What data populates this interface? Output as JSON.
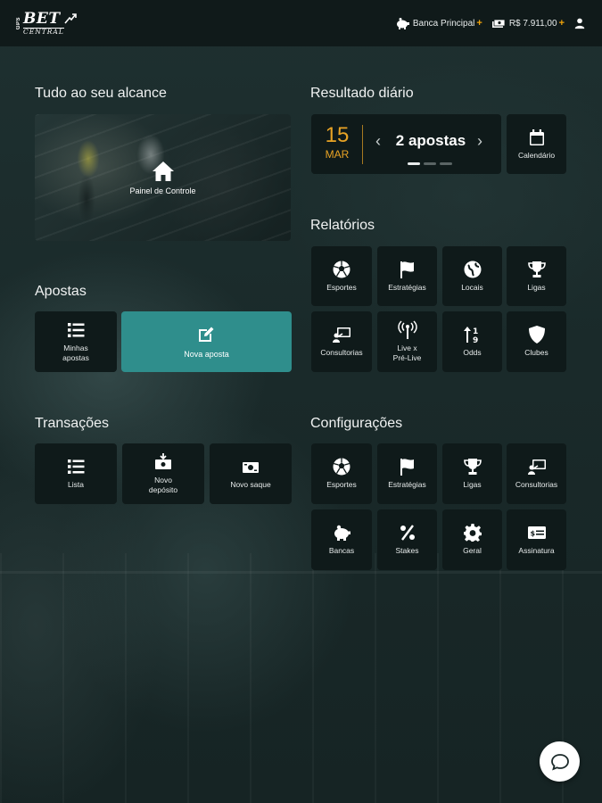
{
  "topbar": {
    "logo_pre": "GPS",
    "logo_bet": "BET",
    "logo_central": "CENTRAL",
    "bank_label": "Banca Principal",
    "bank_icon": "piggy-bank-icon",
    "balance": "R$ 7.911,00",
    "balance_icon": "money-stack-icon",
    "user_icon": "user-icon",
    "accent_color": "#f0a30a"
  },
  "sections": {
    "tudo": "Tudo ao seu alcance",
    "resultado": "Resultado diário",
    "relatorios": "Relatórios",
    "apostas": "Apostas",
    "transacoes": "Transações",
    "configuracoes": "Configurações"
  },
  "hero": {
    "label": "Painel de Controle",
    "icon": "home-icon"
  },
  "daily": {
    "day": "15",
    "month": "MAR",
    "count": "2 apostas",
    "calendar_label": "Calendário",
    "accent": "#e8a325"
  },
  "relatorios": [
    {
      "label": "Esportes",
      "icon": "soccer-ball-icon"
    },
    {
      "label": "Estratégias",
      "icon": "flag-icon"
    },
    {
      "label": "Locais",
      "icon": "globe-icon"
    },
    {
      "label": "Ligas",
      "icon": "trophy-icon"
    },
    {
      "label": "Consultorias",
      "icon": "presentation-icon"
    },
    {
      "label": "Live x",
      "label2": "Pré-Live",
      "icon": "broadcast-icon"
    },
    {
      "label": "Odds",
      "icon": "sort-numeric-icon"
    },
    {
      "label": "Clubes",
      "icon": "shield-icon"
    }
  ],
  "apostas": {
    "minhas_1": "Minhas",
    "minhas_2": "apostas",
    "nova": "Nova aposta",
    "nova_color": "#2f8e8c"
  },
  "transacoes": {
    "lista": "Lista",
    "deposito_1": "Novo",
    "deposito_2": "depósito",
    "saque": "Novo saque"
  },
  "configuracoes": [
    {
      "label": "Esportes",
      "icon": "soccer-ball-icon"
    },
    {
      "label": "Estratégias",
      "icon": "flag-icon"
    },
    {
      "label": "Ligas",
      "icon": "trophy-icon"
    },
    {
      "label": "Consultorias",
      "icon": "presentation-icon"
    },
    {
      "label": "Bancas",
      "icon": "piggy-bank-icon"
    },
    {
      "label": "Stakes",
      "icon": "percent-icon"
    },
    {
      "label": "Geral",
      "icon": "gear-icon"
    },
    {
      "label": "Assinatura",
      "icon": "card-icon"
    }
  ],
  "chat_icon": "chat-bubble-icon"
}
